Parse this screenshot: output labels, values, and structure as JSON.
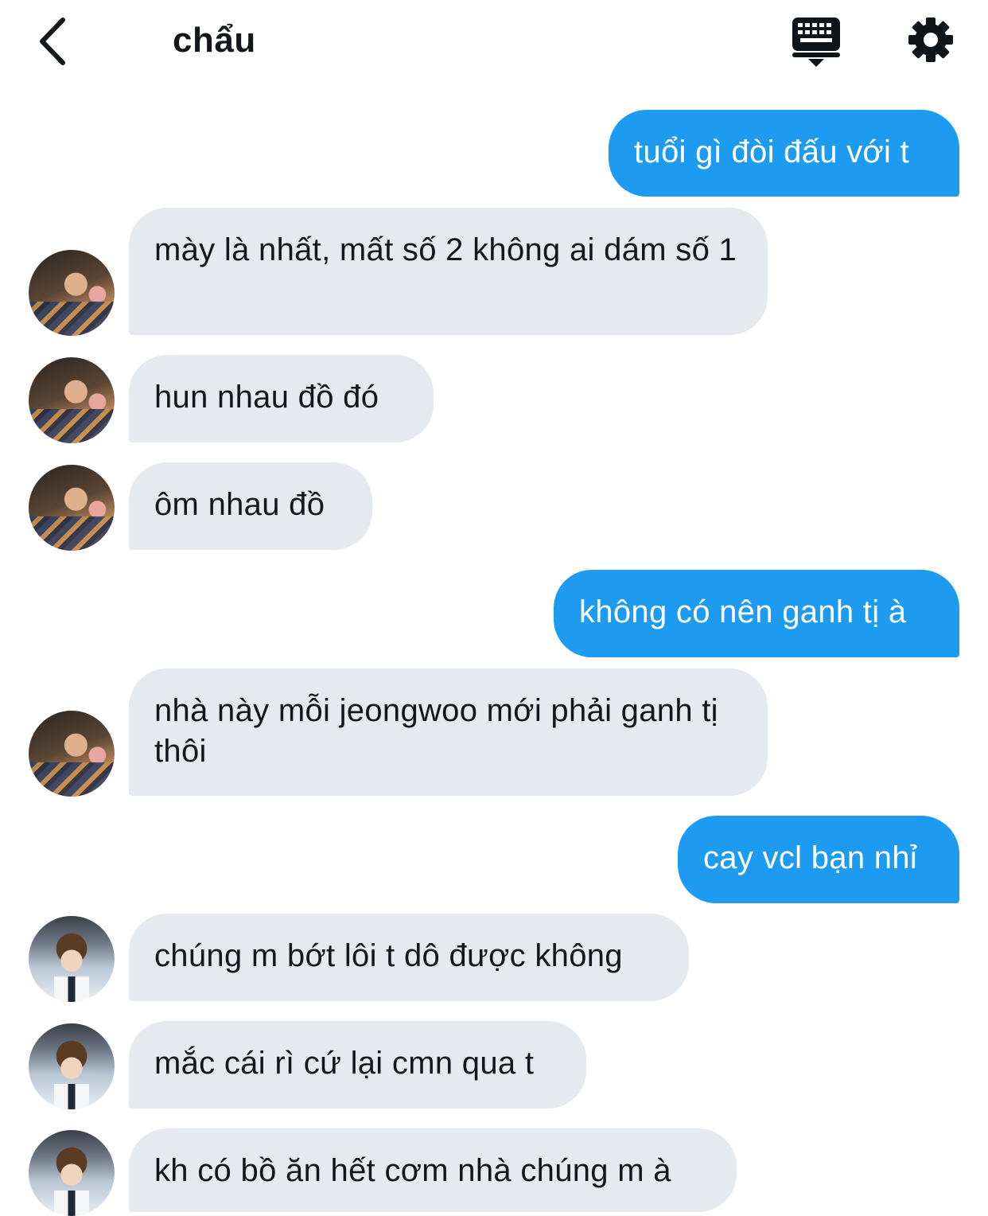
{
  "header": {
    "title": "chẩu",
    "back_icon": "chevron-left-icon",
    "keyboard_icon": "keyboard-icon",
    "settings_icon": "gear-icon"
  },
  "colors": {
    "sent_bubble": "#1d9bf0",
    "received_bubble": "#e6e9ee",
    "text_dark": "#14171a"
  },
  "messages": [
    {
      "direction": "sent",
      "text": "tuổi gì đòi đấu với t"
    },
    {
      "direction": "received",
      "text": "mày là nhất, mất số 2 không ai dám số 1"
    },
    {
      "direction": "received",
      "text": "hun nhau đồ đó"
    },
    {
      "direction": "received",
      "text": "ôm nhau đồ"
    },
    {
      "direction": "sent",
      "text": "không có nên ganh tị à"
    },
    {
      "direction": "received",
      "text": "nhà này mỗi jeongwoo mới phải ganh tị thôi"
    },
    {
      "direction": "sent",
      "text": "cay vcl bạn nhỉ"
    },
    {
      "direction": "received",
      "text": "chúng m bớt lôi t dô được không"
    },
    {
      "direction": "received",
      "text": "mắc cái rì cứ lại cmn qua t"
    },
    {
      "direction": "received",
      "text": "kh có bồ ăn hết cơm nhà chúng m à"
    }
  ]
}
